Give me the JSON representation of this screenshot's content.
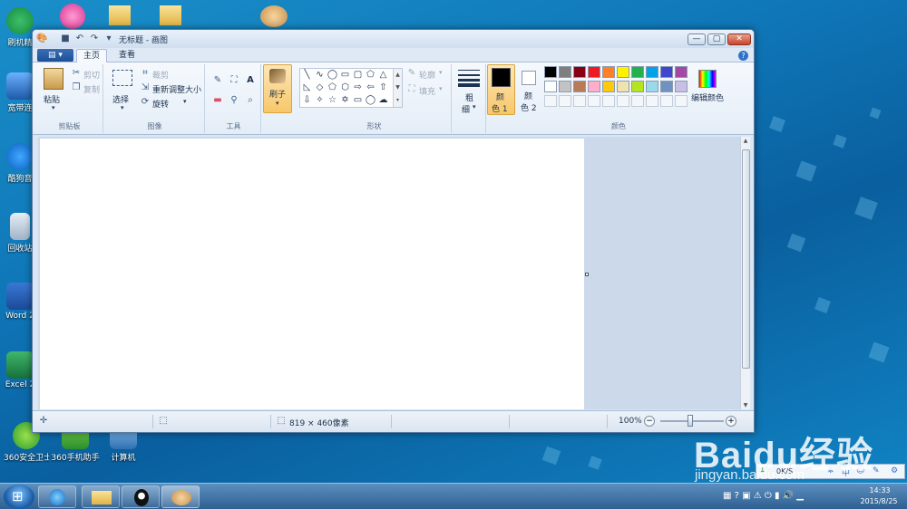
{
  "colors": {
    "desktop": "#0f77b8",
    "window_frame": "#dbe6f3",
    "ribbon_active": "#f8c76a",
    "close_button": "#c9452a"
  },
  "desktop": {
    "icons": [
      {
        "label": "刷机精",
        "icon": "shield-icon"
      },
      {
        "label": "宽带连",
        "icon": "network-icon"
      },
      {
        "label": "酷狗音",
        "icon": "music-icon"
      },
      {
        "label": "回收站",
        "icon": "recycle-bin-icon"
      },
      {
        "label": "Word 2",
        "icon": "word-icon"
      },
      {
        "label": "Excel 2",
        "icon": "excel-icon"
      },
      {
        "label": "360安全卫士",
        "icon": "360-security-icon"
      },
      {
        "label": "360手机助手",
        "icon": "360-phone-icon"
      },
      {
        "label": "计算机",
        "icon": "computer-icon"
      }
    ]
  },
  "window": {
    "title": "无标题 - 画图",
    "tabs": [
      "主页",
      "查看"
    ],
    "controls": {
      "minimize": "—",
      "maximize": "▢",
      "close": "✕"
    },
    "help": "?"
  },
  "ribbon": {
    "clipboard": {
      "paste": "粘贴",
      "cut": "剪切",
      "copy": "复制",
      "label": "剪贴板"
    },
    "image": {
      "select": "选择",
      "crop": "裁剪",
      "resize": "重新调整大小",
      "rotate": "旋转",
      "label": "图像"
    },
    "tools": {
      "label": "工具"
    },
    "brush": {
      "label": "刷子"
    },
    "shapes": {
      "outline": "轮廓",
      "fill": "填充",
      "label": "形状"
    },
    "size": {
      "label1": "粗",
      "label2": "细"
    },
    "colors": {
      "color1_a": "颜",
      "color1_b": "色 1",
      "color2_a": "颜",
      "color2_b": "色 2",
      "edit": "编辑颜色",
      "label": "颜色",
      "color1_value": "#000000",
      "color2_value": "#ffffff",
      "palette_row1": [
        "#000000",
        "#7f7f7f",
        "#880015",
        "#ed1c24",
        "#ff7f27",
        "#fff200",
        "#22b14c",
        "#00a2e8",
        "#3f48cc",
        "#a349a4"
      ],
      "palette_row2": [
        "#ffffff",
        "#c3c3c3",
        "#b97a57",
        "#ffaec9",
        "#ffc90e",
        "#efe4b0",
        "#b5e61d",
        "#99d9ea",
        "#7092be",
        "#c8bfe7"
      ]
    }
  },
  "status": {
    "dimensions": "819 × 460像素",
    "zoom": "100%"
  },
  "taskbar": {
    "time": "14:33",
    "date": "2015/8/25",
    "apps": [
      "ie-icon",
      "explorer-icon",
      "qq-icon",
      "paint-icon"
    ]
  },
  "floating_toolbar": {
    "speed": "0K/S",
    "ime": "中"
  },
  "watermark": {
    "brand": "Baidu经验",
    "url": "jingyan.baidu.com"
  }
}
